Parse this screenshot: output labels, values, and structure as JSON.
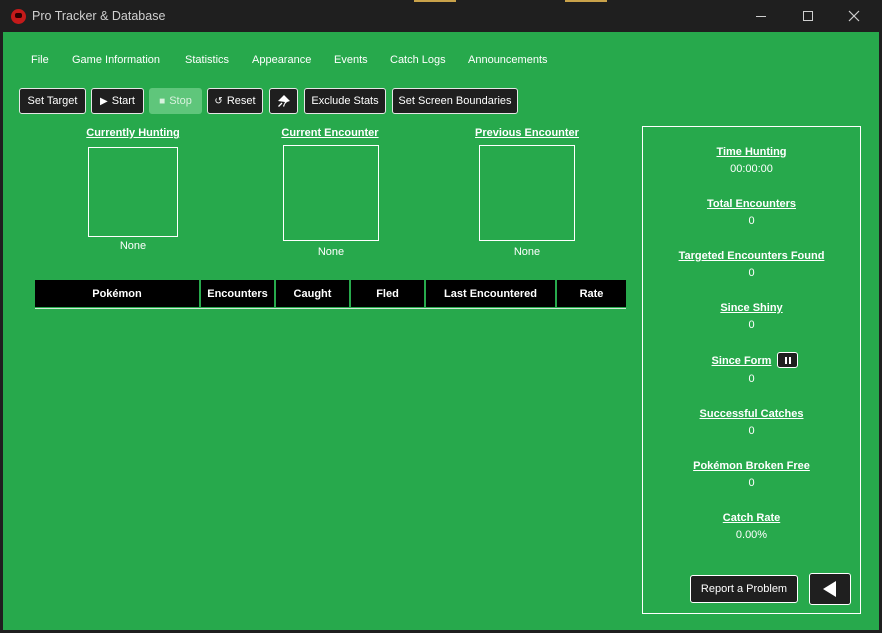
{
  "window": {
    "title": "Pro Tracker & Database",
    "accent_color": "#c9a24a",
    "background_color": "#27a94c",
    "controls": [
      "minimize-icon",
      "maximize-icon",
      "close-icon"
    ]
  },
  "menu": [
    "File",
    "Game Information",
    "Statistics",
    "Appearance",
    "Events",
    "Catch Logs",
    "Announcements"
  ],
  "toolbar": {
    "set_target": "Set Target",
    "start": "Start",
    "stop": "Stop",
    "reset": "Reset",
    "pin_icon": "pin-icon",
    "exclude_stats": "Exclude Stats",
    "set_screen_boundaries": "Set Screen Boundaries"
  },
  "pokemon": {
    "currently_hunting": {
      "label": "Currently Hunting",
      "value": "None"
    },
    "current_encounter": {
      "label": "Current Encounter",
      "value": "None"
    },
    "previous_encounter": {
      "label": "Previous Encounter",
      "value": "None"
    }
  },
  "table": {
    "columns": [
      "Pokémon",
      "Encounters",
      "Caught",
      "Fled",
      "Last Encountered",
      "Rate"
    ],
    "rows": []
  },
  "stats": {
    "time_hunting": {
      "label": "Time Hunting",
      "value": "00:00:00"
    },
    "total_encounters": {
      "label": "Total Encounters",
      "value": "0"
    },
    "targeted_found": {
      "label": "Targeted Encounters Found",
      "value": "0"
    },
    "since_shiny": {
      "label": "Since Shiny",
      "value": "0"
    },
    "since_form": {
      "label": "Since Form",
      "value": "0"
    },
    "successful_catches": {
      "label": "Successful Catches",
      "value": "0"
    },
    "broken_free": {
      "label": "Pokémon Broken Free",
      "value": "0"
    },
    "catch_rate": {
      "label": "Catch Rate",
      "value": "0.00%"
    }
  },
  "footer": {
    "report": "Report a Problem",
    "collapse_icon": "triangle-left-icon"
  }
}
